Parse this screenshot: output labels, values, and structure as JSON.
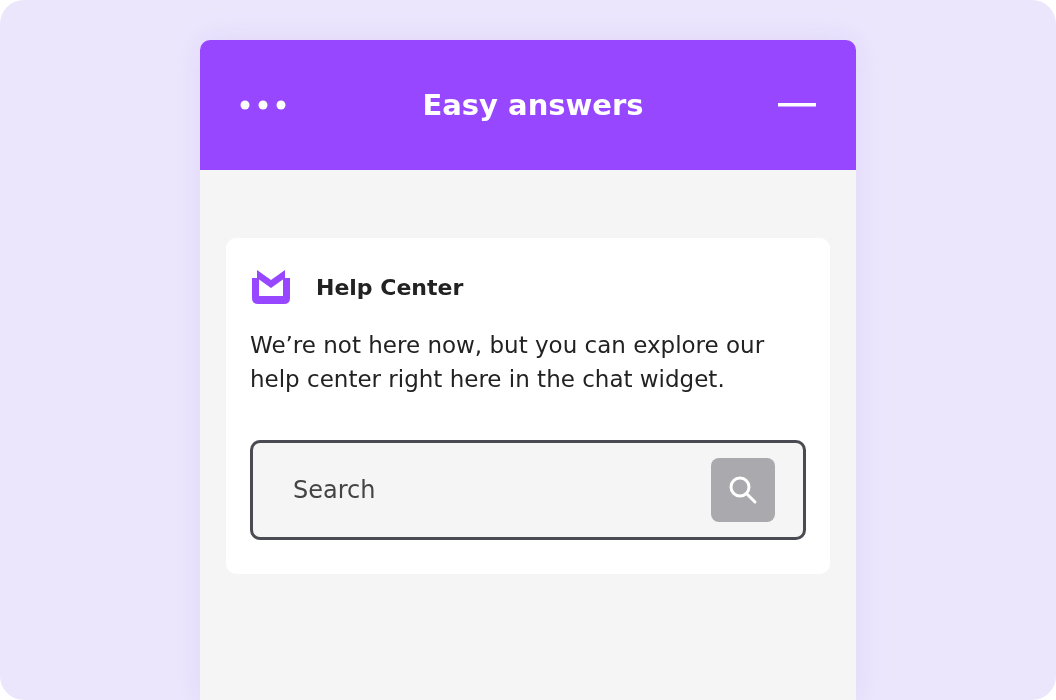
{
  "widget": {
    "title": "Easy answers"
  },
  "card": {
    "title": "Help Center",
    "message": "We’re not here now, but you can explore our help center right here in the chat widget.",
    "search": {
      "placeholder": "Search"
    }
  }
}
